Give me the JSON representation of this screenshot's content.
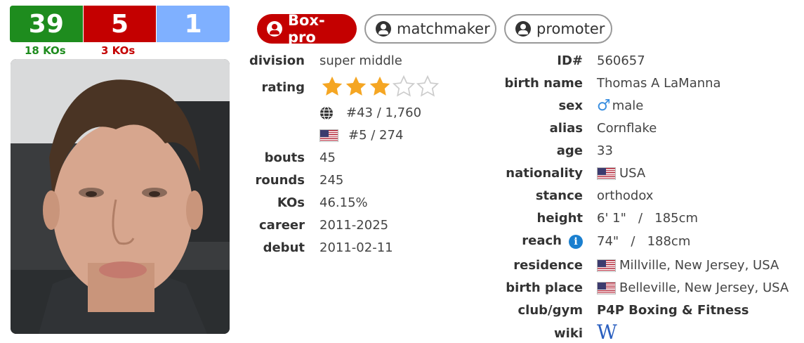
{
  "record": {
    "wins": "39",
    "losses": "5",
    "draws": "1",
    "win_kos": "18 KOs",
    "loss_kos": "3 KOs"
  },
  "roles": {
    "active": "Box-pro",
    "role2": "matchmaker",
    "role3": "promoter"
  },
  "left": {
    "division_label": "division",
    "division": "super middle",
    "rating_label": "rating",
    "rating_stars": 3,
    "rating_max": 5,
    "world_rank": "#43 / 1,760",
    "country_rank": "#5 / 274",
    "bouts_label": "bouts",
    "bouts": "45",
    "rounds_label": "rounds",
    "rounds": "245",
    "kos_label": "KOs",
    "kos": "46.15%",
    "career_label": "career",
    "career": "2011-2025",
    "debut_label": "debut",
    "debut": "2011-02-11"
  },
  "right": {
    "id_label": "ID#",
    "id": "560657",
    "birth_name_label": "birth name",
    "birth_name": "Thomas A LaManna",
    "sex_label": "sex",
    "sex": "male",
    "alias_label": "alias",
    "alias": "Cornflake",
    "age_label": "age",
    "age": "33",
    "nationality_label": "nationality",
    "nationality": "USA",
    "stance_label": "stance",
    "stance": "orthodox",
    "height_label": "height",
    "height": "6' 1\"   /   185cm",
    "reach_label": "reach",
    "reach": "74\"   /   188cm",
    "residence_label": "residence",
    "residence": "Millville, New Jersey, USA",
    "birth_place_label": "birth place",
    "birth_place": "Belleville, New Jersey, USA",
    "club_label": "club/gym",
    "club": "P4P Boxing & Fitness",
    "wiki_label": "wiki",
    "wiki": "W"
  },
  "colors": {
    "win": "#1e8c1e",
    "loss": "#c40000",
    "draw": "#7fb0ff",
    "star": "#f5a623"
  }
}
